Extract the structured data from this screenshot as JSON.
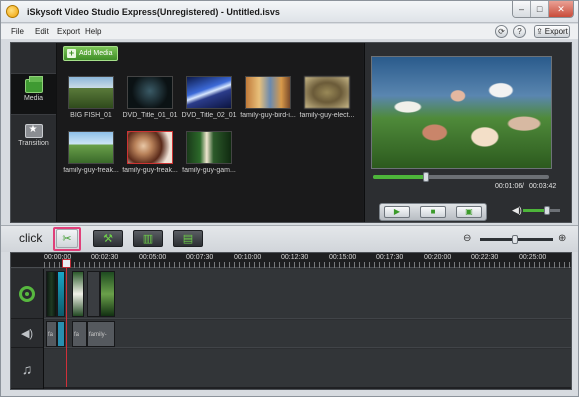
{
  "window": {
    "title": "iSkysoft Video Studio Express(Unregistered) - Untitled.isvs",
    "controls": {
      "minimize": "–",
      "maximize": "□",
      "close": "✕"
    }
  },
  "menu": {
    "items": [
      "File",
      "Edit",
      "Export",
      "Help"
    ],
    "export_button": "Export"
  },
  "sidebar": {
    "tabs": [
      {
        "label": "Media",
        "icon": "media-folder-icon"
      },
      {
        "label": "Transition",
        "icon": "transition-star-icon"
      }
    ]
  },
  "media": {
    "add_label": "Add Media",
    "items": [
      {
        "label": "BIG FISH_01"
      },
      {
        "label": "DVD_Title_01_01"
      },
      {
        "label": "DVD_Title_02_01"
      },
      {
        "label": "family-guy-bird-i..."
      },
      {
        "label": "family-guy-elect..."
      },
      {
        "label": "family-guy-freak..."
      },
      {
        "label": "family-guy-freak..."
      },
      {
        "label": "family-guy-gam..."
      }
    ]
  },
  "preview": {
    "time_current": "00:01:06",
    "time_separator": "/",
    "time_total": "00:03:42",
    "progress_fraction": 0.3,
    "volume_fraction": 0.65
  },
  "toolbar": {
    "annotation": "click",
    "zoom_fraction": 0.48
  },
  "timeline": {
    "ticks": [
      "00:00:00",
      "00:02:30",
      "00:05:00",
      "00:07:30",
      "00:10:00",
      "00:12:30",
      "00:15:00",
      "00:17:30",
      "00:20:00",
      "00:22:30",
      "00:25:00"
    ],
    "clip_labels": [
      "fa",
      "fa",
      "family-"
    ]
  },
  "colors": {
    "accent_green": "#4db53a",
    "highlight_pink": "#e0407a",
    "playhead_red": "#d0303a"
  }
}
